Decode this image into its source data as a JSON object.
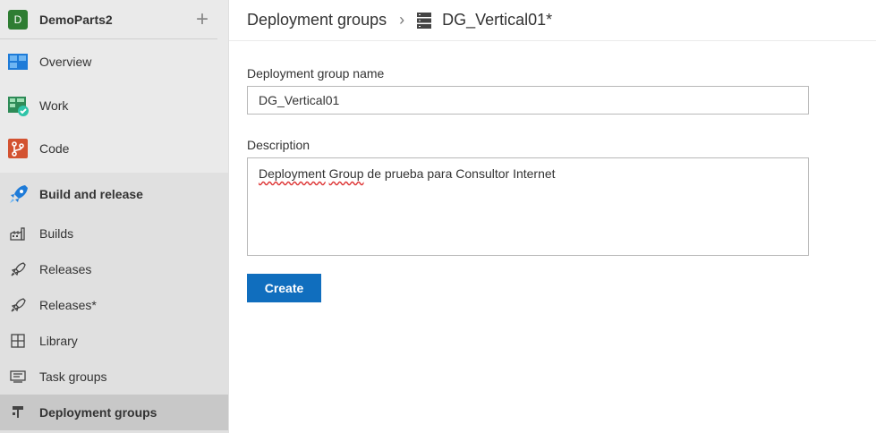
{
  "project": {
    "initial": "D",
    "name": "DemoParts2"
  },
  "nav": {
    "overview": "Overview",
    "work": "Work",
    "code": "Code",
    "build_release": "Build and release",
    "builds": "Builds",
    "releases": "Releases",
    "releases_star": "Releases*",
    "library": "Library",
    "task_groups": "Task groups",
    "deployment_groups": "Deployment groups"
  },
  "header": {
    "breadcrumb_parent": "Deployment groups",
    "breadcrumb_current": "DG_Vertical01*"
  },
  "form": {
    "name_label": "Deployment group name",
    "name_value": "DG_Vertical01",
    "desc_label": "Description",
    "desc_word1": "Deployment",
    "desc_word2": "Group",
    "desc_rest": " de prueba para Consultor Internet",
    "create_label": "Create"
  },
  "colors": {
    "primary_button": "#106ebe",
    "project_badge": "#2e7d32",
    "sidebar_bg": "#eaeaea"
  }
}
